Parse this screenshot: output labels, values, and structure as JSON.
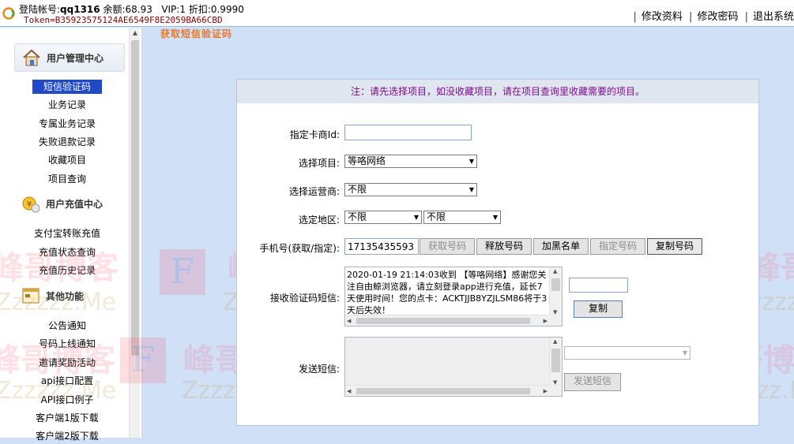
{
  "topbar": {
    "account_label": "登陆帐号:",
    "account": "qq1316",
    "balance_label": "余额:",
    "balance": "68.93",
    "vip_label": "VIP:",
    "vip": "1",
    "discount_label": "折扣:",
    "discount": "0.9990",
    "token_label": "Token=",
    "token": "B35923575124AE6549F8E2059BA66CBD",
    "links": [
      "修改资料",
      "修改密码",
      "退出系统"
    ]
  },
  "sidebar": {
    "user_center": "用户管理中心",
    "user_items": [
      "短信验证码",
      "业务记录",
      "专属业务记录",
      "失败退款记录",
      "收藏项目",
      "项目查询"
    ],
    "recharge_center": "用户充值中心",
    "recharge_items": [
      "支付宝转账充值",
      "充值状态查询",
      "充值历史记录"
    ],
    "other": "其他功能",
    "other_items": [
      "公告通知",
      "号码上线通知",
      "邀请奖励活动",
      "api接口配置",
      "API接口例子",
      "客户端1版下载",
      "客户端2版下载"
    ]
  },
  "main": {
    "title": "获取短信验证码",
    "notice": "注：请先选择项目，如没收藏项目，请在项目查询里收藏需要的项目。",
    "merchant_id_label": "指定卡商Id:",
    "merchant_id_value": "",
    "project_label": "选择项目:",
    "project_value": "等咯网络",
    "operator_label": "选择运营商:",
    "operator_value": "不限",
    "region_label": "选定地区:",
    "region_value_1": "不限",
    "region_value_2": "不限",
    "phone_label": "手机号(获取/指定):",
    "phone_value": "17135435593",
    "buttons": {
      "get": "获取号码",
      "release": "释放号码",
      "blacklist": "加黑名单",
      "assign": "指定号码",
      "copy_number": "复制号码"
    },
    "sms_label": "接收验证码短信:",
    "sms_text": "2020-01-19 21:14:03收到 【等咯网络】感谢您关注自由鲸浏览器，请立刻登录app进行充值，延长7天使用时间！您的点卡：ACKTJJB8YZJLSM86将于3天后失效！",
    "code_value": "",
    "copy": "复制",
    "send_label": "发送短信:",
    "send_text": "",
    "send_select": "",
    "send_button": "发送短信"
  },
  "watermark": {
    "cn": "峰哥博客",
    "letter": "F",
    "domain": "Zzzzzz.Me"
  }
}
